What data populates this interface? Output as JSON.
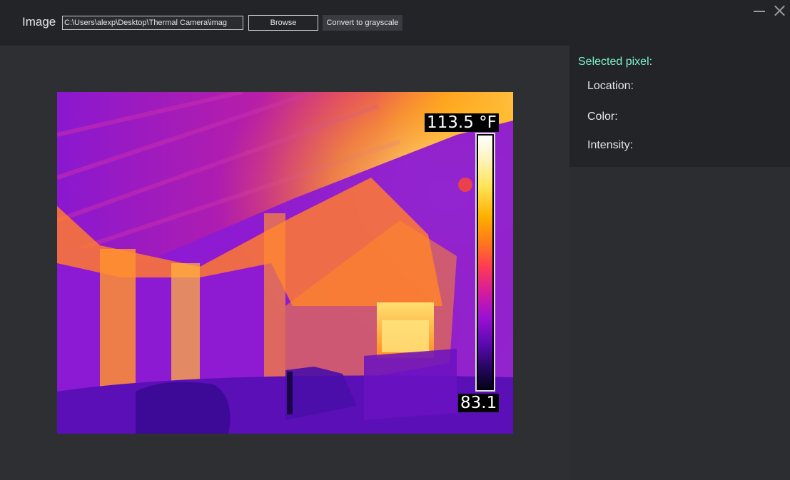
{
  "toolbar": {
    "image_label": "Image",
    "path_value": "C:\\Users\\alexp\\Desktop\\Thermal Camera\\imag",
    "browse_label": "Browse",
    "grayscale_label": "Convert to grayscale"
  },
  "window_controls": {
    "minimize_icon": "minimize-icon",
    "close_icon": "close-icon"
  },
  "thermal_image": {
    "max_label": "113.5 °F",
    "min_label": "83.1"
  },
  "panel": {
    "title": "Selected pixel:",
    "location_label": "Location:",
    "color_label": "Color:",
    "intensity_label": "Intensity:"
  },
  "colors": {
    "accent": "#7cf5c8",
    "background": "#2e2f33",
    "toolbar": "#232428"
  }
}
